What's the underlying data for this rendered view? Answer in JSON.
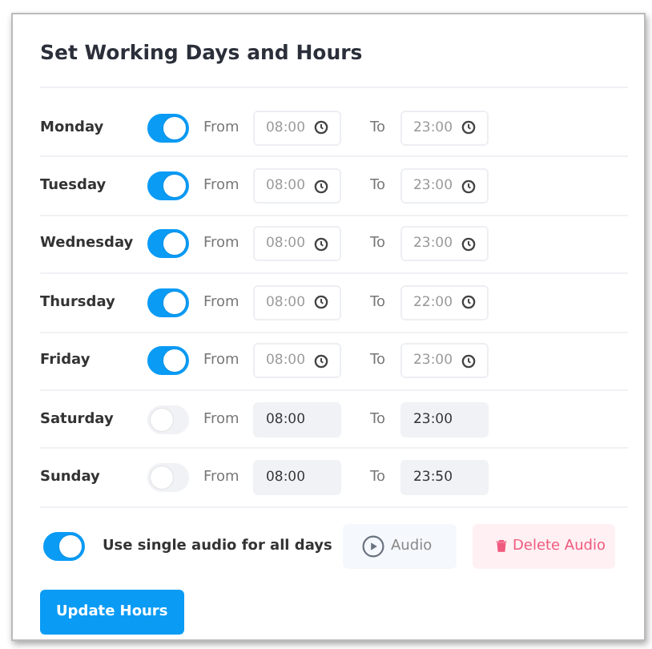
{
  "title": "Set Working Days and Hours",
  "days": [
    {
      "name": "Monday",
      "on": true,
      "from_label": "From",
      "from": "08:00",
      "to_label": "To",
      "to": "23:00"
    },
    {
      "name": "Tuesday",
      "on": true,
      "from_label": "From",
      "from": "08:00",
      "to_label": "To",
      "to": "23:00"
    },
    {
      "name": "Wednesday",
      "on": true,
      "from_label": "From",
      "from": "08:00",
      "to_label": "To",
      "to": "23:00"
    },
    {
      "name": "Thursday",
      "on": true,
      "from_label": "From",
      "from": "08:00",
      "to_label": "To",
      "to": "22:00"
    },
    {
      "name": "Friday",
      "on": true,
      "from_label": "From",
      "from": "08:00",
      "to_label": "To",
      "to": "23:00"
    },
    {
      "name": "Saturday",
      "on": false,
      "from_label": "From",
      "from": "08:00",
      "to_label": "To",
      "to": "23:00"
    },
    {
      "name": "Sunday",
      "on": false,
      "from_label": "From",
      "from": "08:00",
      "to_label": "To",
      "to": "23:50"
    }
  ],
  "single_audio": {
    "on": true,
    "label": "Use single audio for all days"
  },
  "audio_button": "Audio",
  "delete_button": "Delete Audio",
  "update_button": "Update Hours"
}
